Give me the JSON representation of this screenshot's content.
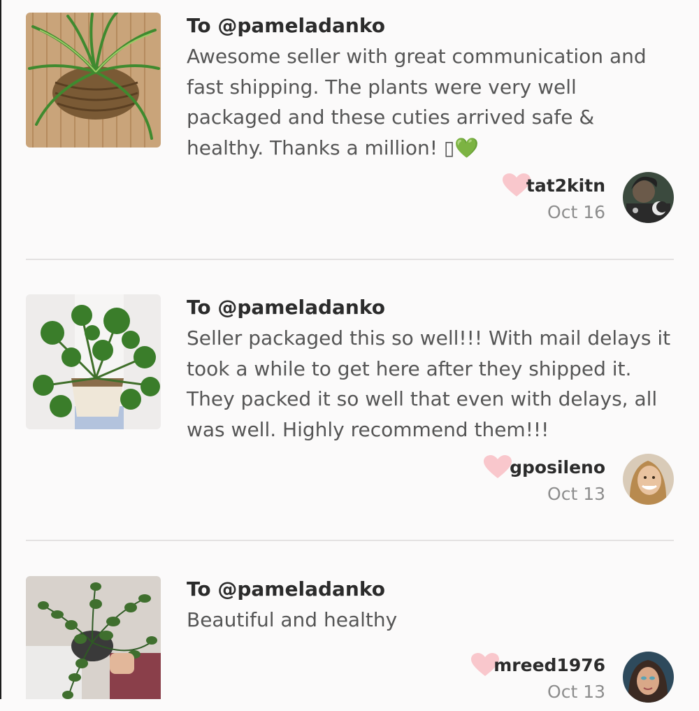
{
  "reviews": [
    {
      "to": "To @pameladanko",
      "text": "Awesome seller with great communication and fast shipping. The plants were very well packaged and these cuties arrived safe & healthy. Thanks a million! ▯💚",
      "username": "tat2kitn",
      "date": "Oct 16",
      "heart_color": "#f9c7cc"
    },
    {
      "to": "To @pameladanko",
      "text": "Seller packaged this so well!!! With mail delays it took a while to get here after they shipped it. They packed it so well that even with delays, all was well. Highly recommend them!!!",
      "username": "gposileno",
      "date": "Oct 13",
      "heart_color": "#f9c7cc"
    },
    {
      "to": "To @pameladanko",
      "text": "Beautiful and healthy",
      "username": "mreed1976",
      "date": "Oct 13",
      "heart_color": "#f9c7cc"
    }
  ]
}
